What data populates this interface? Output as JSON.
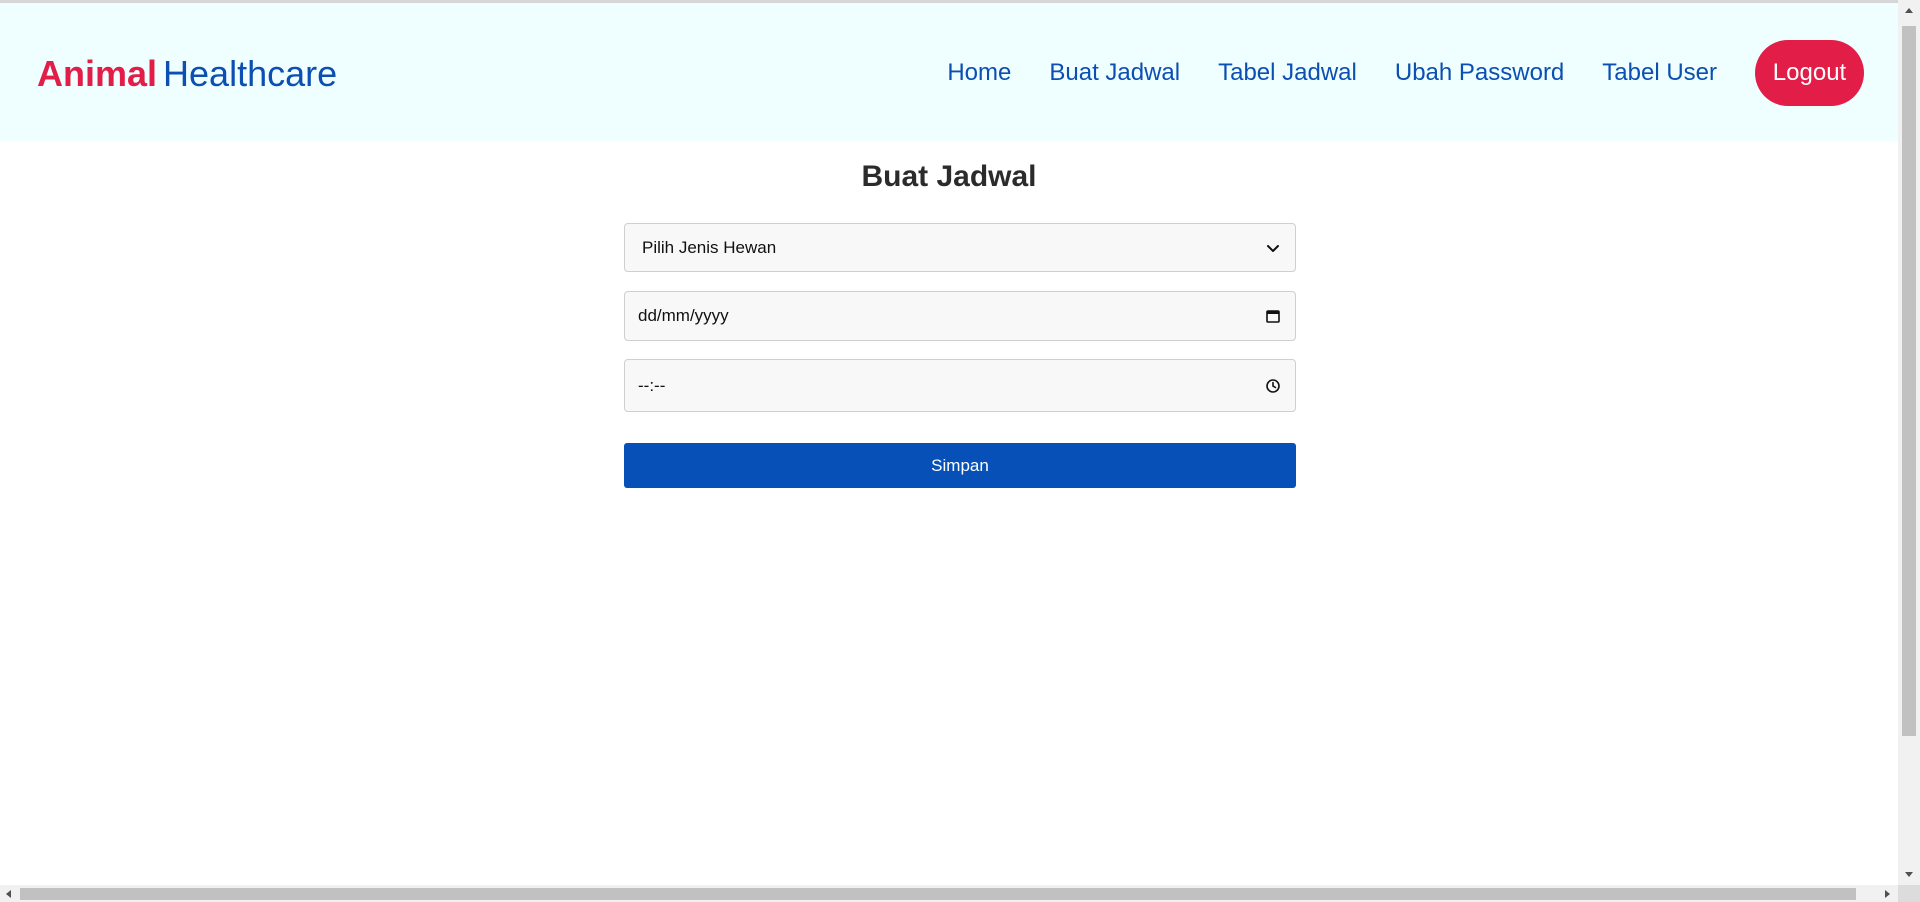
{
  "brand": {
    "part1": "Animal",
    "part2": "Healthcare"
  },
  "nav": {
    "items": [
      "Home",
      "Buat Jadwal",
      "Tabel Jadwal",
      "Ubah Password",
      "Tabel User"
    ],
    "logout_label": "Logout"
  },
  "form": {
    "title": "Buat Jadwal",
    "animal_select": {
      "value": "Pilih Jenis Hewan",
      "icon": "chevron-down-icon"
    },
    "date_field": {
      "value": "dd/mm/yyyy",
      "icon": "calendar-icon"
    },
    "time_field": {
      "value": "--:--",
      "icon": "clock-icon"
    },
    "save_label": "Simpan"
  },
  "colors": {
    "brand_red": "#e11d48",
    "brand_blue": "#0b4fb3",
    "header_bg": "#effefe",
    "button_blue": "#0650b8"
  }
}
